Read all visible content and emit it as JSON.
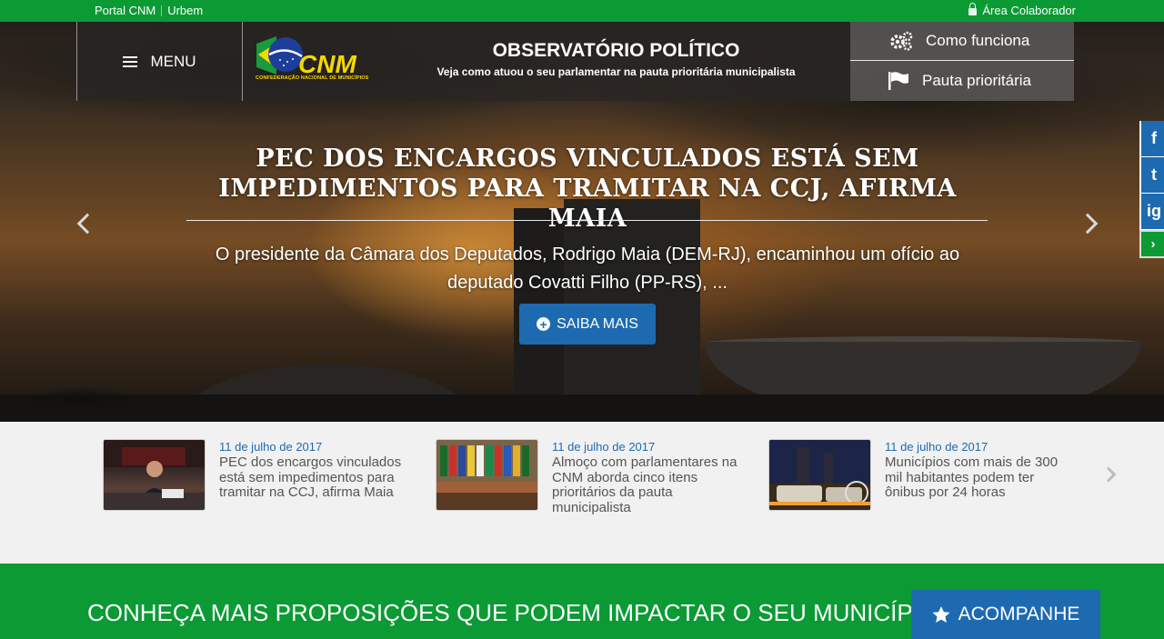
{
  "topbar": {
    "portal_label": "Portal CNM",
    "urbem_label": "Urbem",
    "colaborador_label": "Área Colaborador"
  },
  "header": {
    "menu_label": "MENU",
    "logo_text": "CNM",
    "logo_subtitle": "CONFEDERAÇÃO NACIONAL DE MUNICÍPIOS",
    "title": "OBSERVATÓRIO POLÍTICO",
    "subtitle": "Veja como atuou o seu parlamentar na pauta prioritária municipalista",
    "como_funciona_label": "Como funciona",
    "pauta_label": "Pauta prioritária",
    "gear_icon": "gears-icon",
    "flag_icon": "flag-icon"
  },
  "social": {
    "facebook": "f",
    "twitter": "t",
    "instagram": "ig",
    "toggle": "›"
  },
  "slide": {
    "title": "PEC DOS ENCARGOS VINCULADOS ESTÁ SEM IMPEDIMENTOS PARA TRAMITAR NA CCJ, AFIRMA MAIA",
    "description": "O presidente da Câmara dos Deputados, Rodrigo Maia (DEM-RJ), encaminhou um ofício ao deputado Covatti Filho (PP-RS), ...",
    "button_label": "SAIBA MAIS"
  },
  "news": [
    {
      "date": "11 de julho de 2017",
      "text": "PEC dos encargos vinculados está sem impedimentos para tramitar na CCJ, afirma Maia"
    },
    {
      "date": "11 de julho de 2017",
      "text": "Almoço com parlamentares na CNM aborda cinco itens prioritários da pauta municipalista"
    },
    {
      "date": "11 de julho de 2017",
      "text": "Municípios com mais de 300 mil habitantes podem ter ônibus por 24 horas"
    }
  ],
  "band": {
    "text": "CONHEÇA MAIS PROPOSIÇÕES QUE PODEM IMPACTAR O SEU MUNICÍPIO",
    "button_label": "ACOMPANHE"
  },
  "colors": {
    "green": "#0c9a35",
    "blue": "#1d6ab1",
    "date_blue": "#1d6ab1"
  }
}
